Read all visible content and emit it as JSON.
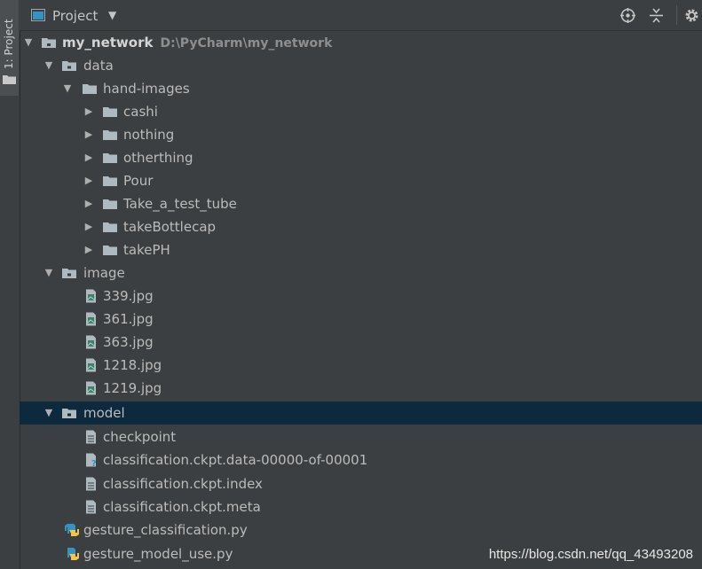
{
  "sidebar": {
    "tab_label": "1: Project"
  },
  "header": {
    "title": "Project",
    "caret": "▼",
    "tools": [
      "crosshair-icon",
      "collapse-all-icon",
      "gear-icon"
    ]
  },
  "tree": {
    "root": {
      "name": "my_network",
      "path": "D:\\PyCharm\\my_network"
    },
    "data": {
      "name": "data"
    },
    "hand_images": {
      "name": "hand-images"
    },
    "hand_children": [
      "cashi",
      "nothing",
      "otherthing",
      "Pour",
      "Take_a_test_tube",
      "takeBottlecap",
      "takePH"
    ],
    "image": {
      "name": "image"
    },
    "image_files": [
      "339.jpg",
      "361.jpg",
      "363.jpg",
      "1218.jpg",
      "1219.jpg"
    ],
    "model": {
      "name": "model"
    },
    "model_files": [
      {
        "name": "checkpoint",
        "icon": "text-file-icon"
      },
      {
        "name": "classification.ckpt.data-00000-of-00001",
        "icon": "unknown-file-icon"
      },
      {
        "name": "classification.ckpt.index",
        "icon": "text-file-icon"
      },
      {
        "name": "classification.ckpt.meta",
        "icon": "text-file-icon"
      }
    ],
    "py_files": [
      "gesture_classification.py",
      "gesture_model_use.py"
    ]
  },
  "colors": {
    "background": "#3c3f41",
    "selection": "#0d293e",
    "text": "#bbbbbb"
  },
  "watermark": "https://blog.csdn.net/qq_43493208"
}
